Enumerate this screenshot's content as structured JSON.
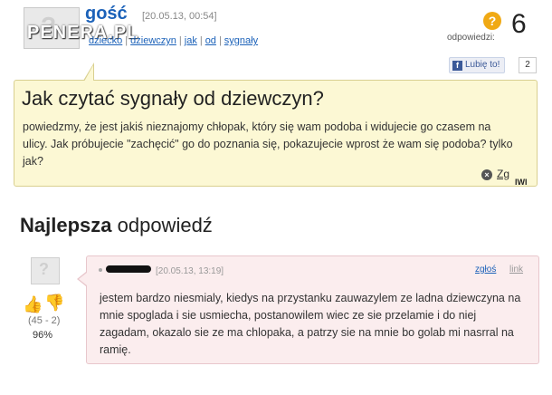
{
  "watermark": "PENERA.PL",
  "question": {
    "author": "gość",
    "date": "[20.05.13, 00:54]",
    "categories": [
      "dziecko",
      "dziewczyn",
      "jak",
      "od",
      "sygnały"
    ],
    "answers_label": "odpowiedzi:",
    "answers_count": "6",
    "like_label": "Lubię to!",
    "like_count": "2",
    "title": "Jak czytać sygnały od dziewczyn?",
    "body": "powiedzmy, że jest jakiś nieznajomy chłopak, który się wam podoba i widujecie go czasem na ulicy. Jak próbujecie \"zachęcić\" go do poznania się, pokazujecie wprost że wam się podoba? tylko jak?",
    "report_label": "Zg",
    "corner_mark": "IWI"
  },
  "best_answer": {
    "heading_bold": "Najlepsza",
    "heading_rest": " odpowiedź",
    "votes": "(45 - 2)",
    "percent": "96%",
    "date": "[20.05.13, 13:19]",
    "report_label": "zgłoś",
    "link_label": "link",
    "body": "jestem bardzo niesmialy, kiedys na przystanku zauwazylem ze ladna dziewczyna na mnie spoglada i sie usmiecha, postanowilem wiec ze sie przelamie i do niej zagadam, okazalo sie ze ma chlopaka, a patrzy sie na mnie bo golab mi nasrral na ramię."
  },
  "colors": {
    "link": "#1c62b9",
    "question_bg": "#fcf8d4",
    "answer_bg": "#fbedee",
    "answers_badge": "#f0a914",
    "facebook": "#3b5998"
  },
  "icons": {
    "answers": "question-badge-icon",
    "like": "facebook-f-icon",
    "close": "close-circle-icon",
    "thumb_up": "thumb-up-icon",
    "thumb_down": "thumb-down-icon"
  }
}
